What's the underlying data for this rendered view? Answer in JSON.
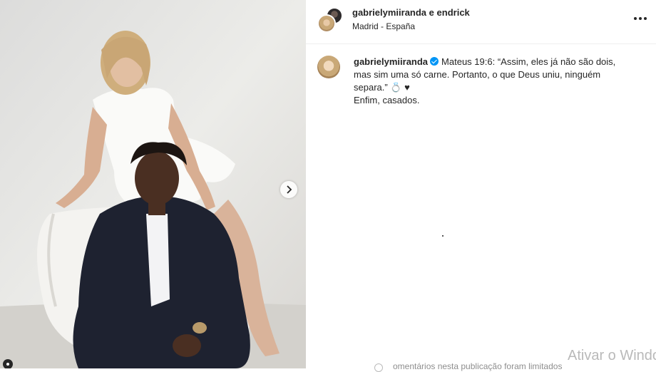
{
  "post": {
    "photo_alt": "",
    "header": {
      "user1": "gabrielymiiranda",
      "conjunction": "e",
      "user2": "endrick",
      "location": "Madrid - España"
    },
    "caption": {
      "username": "gabrielymiiranda",
      "text": "Mateus 19:6: “Assim, eles já não são dois, mas sim uma só carne. Portanto, o que Deus uniu, ninguém separa.” 💍 ♥",
      "line2": "Enfim, casados."
    },
    "footer_note": "omentários nesta publicação foram limitados",
    "icons": {
      "more": "more-options-icon",
      "next": "chevron-right-icon",
      "verified": "verified-badge-icon"
    }
  },
  "overlay": {
    "watermark": "Ativar o Windo"
  },
  "colors": {
    "verified": "#0095f6",
    "text": "#262626",
    "muted": "#8e8e8e"
  }
}
